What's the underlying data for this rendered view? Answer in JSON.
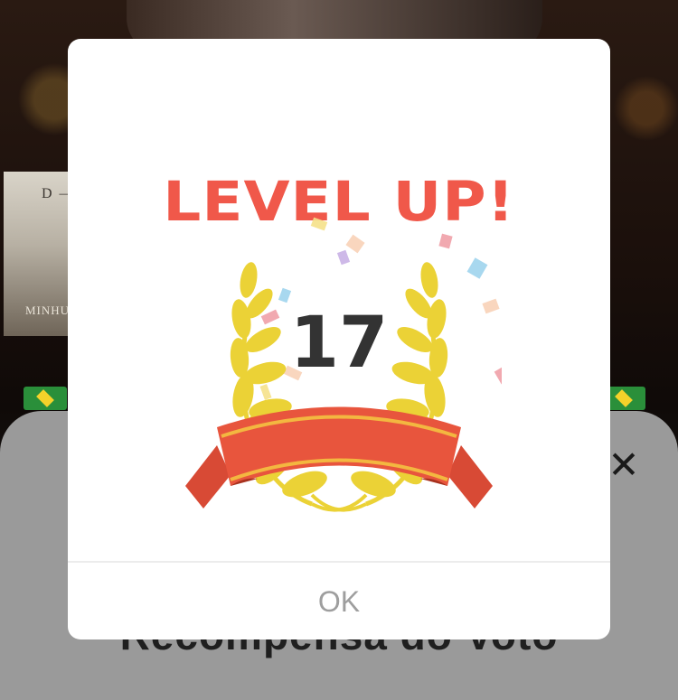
{
  "background": {
    "poster_title": "D —",
    "poster_subtitle": "MINHU"
  },
  "sheet": {
    "title": "Recompensa do Voto",
    "close_icon": "close-icon"
  },
  "modal": {
    "heading": "LEVEL UP!",
    "level": "17",
    "ok_label": "OK",
    "heading_color": "#f0584a",
    "laurel_color": "#ebd236",
    "ribbon_color": "#e8553d"
  }
}
